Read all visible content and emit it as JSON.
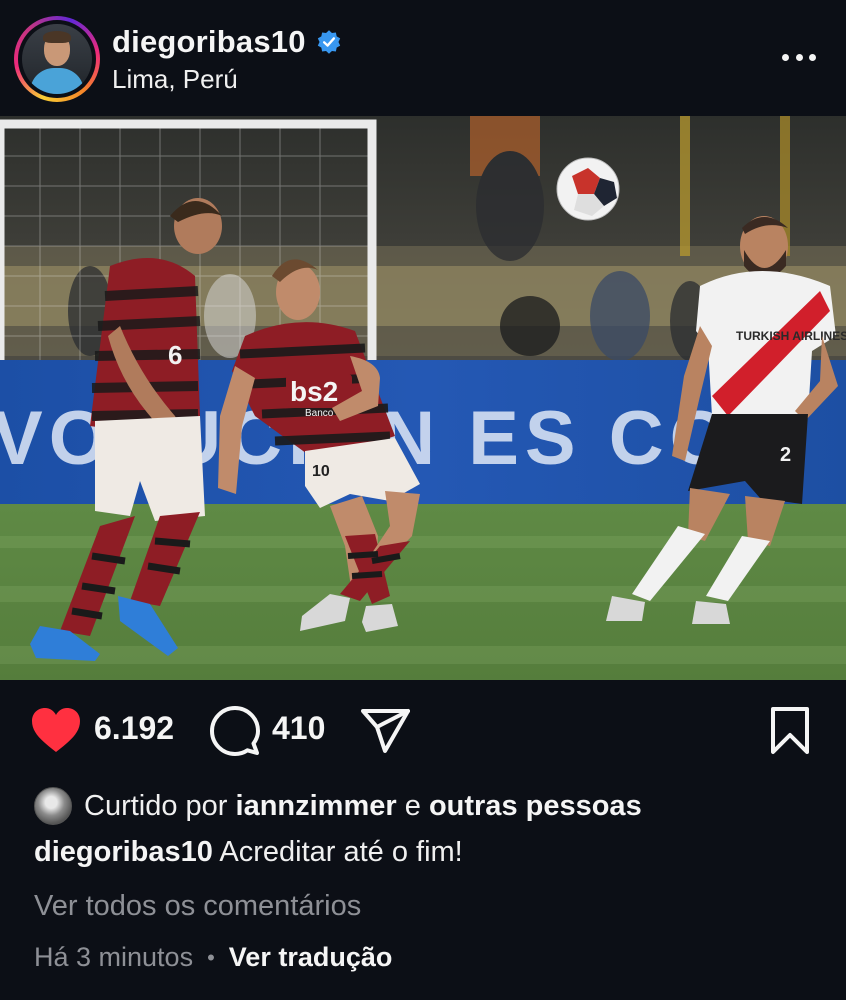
{
  "header": {
    "username": "diegoribas10",
    "location": "Lima, Perú",
    "verified_color": "#3897f0"
  },
  "photo": {
    "banner_text": "VOLUCIÓN ES CON",
    "shirt_sponsor": "bs2",
    "shirt_sub": "Banco",
    "shorts_number": "10",
    "opponent_sponsor": "TURKISH AIRLINES",
    "opponent_number": "2",
    "left_player_number": "6"
  },
  "actions": {
    "like_count": "6.192",
    "comment_count": "410",
    "like_color": "#ff3040"
  },
  "likes": {
    "prefix": "Curtido por ",
    "user": "iannzimmer",
    "conjunction": " e ",
    "others": "outras pessoas"
  },
  "caption": {
    "username": "diegoribas10",
    "text": " Acreditar até o fim!"
  },
  "comments": {
    "view_all": "Ver todos os comentários"
  },
  "meta": {
    "time": "Há 3 minutos",
    "separator": "•",
    "translate": "Ver tradução"
  }
}
